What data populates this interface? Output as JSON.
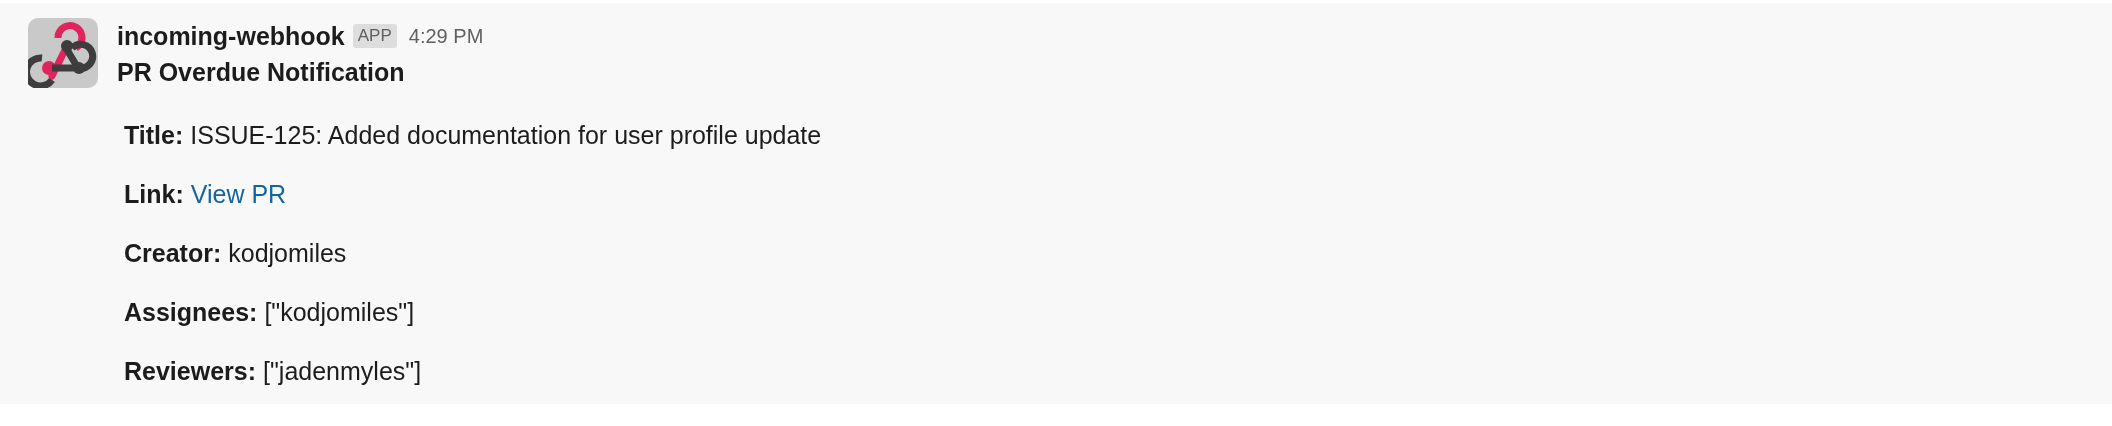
{
  "message": {
    "sender": "incoming-webhook",
    "badge": "APP",
    "time": "4:29 PM",
    "heading": "PR Overdue Notification",
    "fields": [
      {
        "label": "Title:",
        "value": "ISSUE-125: Added documentation for user profile update",
        "kind": "text"
      },
      {
        "label": "Link:",
        "value": "View PR",
        "kind": "link"
      },
      {
        "label": "Creator:",
        "value": "kodjomiles",
        "kind": "text"
      },
      {
        "label": "Assignees:",
        "value": "[\"kodjomiles\"]",
        "kind": "text"
      },
      {
        "label": "Reviewers:",
        "value": "[\"jadenmyles\"]",
        "kind": "text"
      }
    ]
  }
}
